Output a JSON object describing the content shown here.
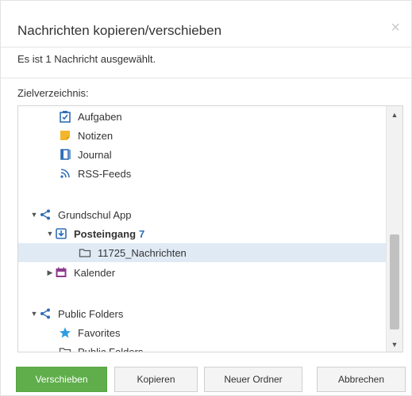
{
  "dialog": {
    "title": "Nachrichten kopieren/verschieben",
    "close_glyph": "×",
    "info": "Es ist 1 Nachricht ausgewählt.",
    "target_label": "Zielverzeichnis:"
  },
  "tree": {
    "items": [
      {
        "label": "Aufgaben",
        "icon": "tasks-icon"
      },
      {
        "label": "Notizen",
        "icon": "notes-icon"
      },
      {
        "label": "Journal",
        "icon": "journal-icon"
      },
      {
        "label": "RSS-Feeds",
        "icon": "rss-icon"
      },
      {
        "label": "Grundschul App",
        "icon": "share-icon",
        "expanded": true
      },
      {
        "label": "Posteingang",
        "icon": "inbox-icon",
        "count": "7",
        "expanded": true
      },
      {
        "label": "11725_Nachrichten",
        "icon": "folder-icon",
        "selected": true
      },
      {
        "label": "Kalender",
        "icon": "calendar-icon",
        "expanded": false
      },
      {
        "label": "Public Folders",
        "icon": "share-icon",
        "expanded": true
      },
      {
        "label": "Favorites",
        "icon": "star-icon"
      },
      {
        "label": "Public Folders",
        "icon": "folder-icon"
      }
    ]
  },
  "buttons": {
    "move": "Verschieben",
    "copy": "Kopieren",
    "new_folder": "Neuer Ordner",
    "cancel": "Abbrechen"
  },
  "colors": {
    "primary_button": "#5fae4b",
    "selected_row": "#dfeaf5",
    "count": "#2f6db5",
    "calendar_icon": "#8e3a8c",
    "notes_icon": "#f3b52a",
    "accent_icon": "#2f6db5"
  }
}
